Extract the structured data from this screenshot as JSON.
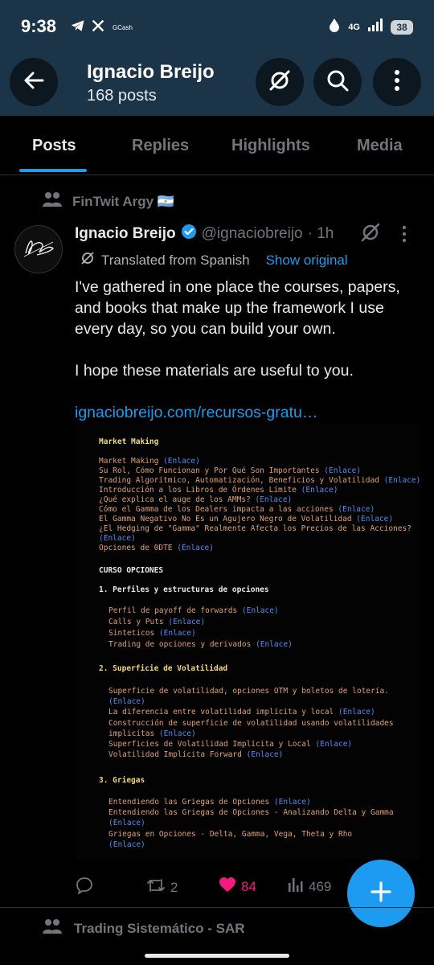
{
  "status_bar": {
    "time": "9:38",
    "left_icons": [
      "telegram-icon",
      "x-icon"
    ],
    "gcash": "GCash",
    "network": "4G",
    "battery": "38"
  },
  "header": {
    "title": "Ignacio Breijo",
    "subtitle": "168 posts",
    "bg_color": "#1b3448"
  },
  "tabs": [
    {
      "label": "Posts",
      "active": true
    },
    {
      "label": "Replies",
      "active": false
    },
    {
      "label": "Highlights",
      "active": false
    },
    {
      "label": "Media",
      "active": false
    }
  ],
  "post": {
    "social_context": "FinTwit Argy 🇦🇷",
    "author": "Ignacio Breijo",
    "verified": true,
    "handle": "@ignaciobreijo",
    "time": "· 1h",
    "translated_label": "Translated from Spanish",
    "show_original": "Show original",
    "text_p1": "I've gathered in one place the courses, papers, and books that make up the framework I use every day, so you can build your own.",
    "text_p2": "I hope these materials are useful to you.",
    "link": "ignaciobreijo.com/recursos-gratu…",
    "media": {
      "section1_title": "Market Making",
      "s1": [
        "Market Making ",
        "(Enlace)",
        "Su Rol, Cómo Funcionan y Por Qué Son Importantes ",
        "(Enlace)",
        "Trading Algorítmico, Automatización, Beneficios y Volatilidad ",
        "(Enlace)",
        "Introducción a los Libros de Órdenes Límite ",
        "(Enlace)",
        "¿Qué explica el auge de los AMMs? ",
        "(Enlace)",
        "Cómo el Gamma de los Dealers impacta a las acciones ",
        "(Enlace)",
        "El Gamma Negativo No Es un Agujero Negro de Volatilidad ",
        "(Enlace)",
        "¿El Hedging de \"Gamma\" Realmente Afecta los Precios de las Acciones?",
        "(Enlace)",
        "Opciones de 0DTE ",
        "(Enlace)"
      ],
      "section2_title": "CURSO OPCIONES",
      "sub1_title": "1. Perfiles y estructuras de opciones",
      "sub1": [
        "Perfil de payoff de forwards ",
        "(Enlace)",
        "Calls y Puts ",
        "(Enlace)",
        "Sinteticos ",
        "(Enlace)",
        "Trading de opciones y derivados ",
        "(Enlace)"
      ],
      "sub2_title": "2. Superficie de Volatilidad",
      "sub2": [
        "Superficie de volatilidad, opciones OTM y boletos de lotería.",
        "(Enlace)",
        "La diferencia entre volatilidad implícita y local ",
        "(Enlace)",
        "Construcción de superficie de volatilidad usando volatilidades",
        "implicitas ",
        "(Enlace)",
        "Superficies de Volatilidad Implícita y Local ",
        "(Enlace)",
        "Volatilidad Implícita Forward ",
        "(Enlace)"
      ],
      "sub3_title": "3. Griegas",
      "sub3": [
        "Entendiendo las Griegas de Opciones ",
        "(Enlace)",
        "Entendiendo las Griegas de Opciones - Analizando Delta y Gamma",
        "(Enlace)",
        "Griegas en Opciones - Delta, Gamma, Vega, Theta y Rho",
        "(Enlace)"
      ]
    },
    "actions": {
      "replies": "",
      "reposts": "2",
      "likes": "84",
      "views": "469"
    }
  },
  "next_post": {
    "social_context": "Trading Sistemático - SAR"
  },
  "colors": {
    "accent": "#1d9bf0",
    "like": "#f91880",
    "muted": "#71767b"
  }
}
